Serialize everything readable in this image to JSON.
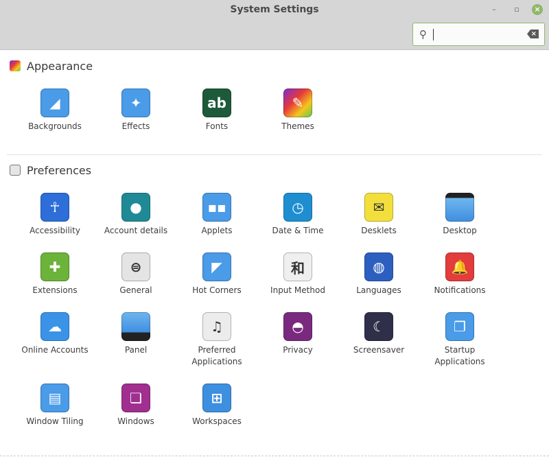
{
  "window": {
    "title": "System Settings",
    "minimize": "–",
    "restore": "▫",
    "close": "×"
  },
  "search": {
    "value": "",
    "icon": "search-icon",
    "clear_icon": "clear-icon"
  },
  "sections": [
    {
      "id": "appearance",
      "title": "Appearance",
      "icon": "appearance-icon",
      "items": [
        {
          "label": "Backgrounds",
          "icon": "backgrounds-icon",
          "bg": "#4a9be8"
        },
        {
          "label": "Effects",
          "icon": "effects-icon",
          "bg": "#4a9be8"
        },
        {
          "label": "Fonts",
          "icon": "fonts-icon",
          "bg": "#1d5a3a"
        },
        {
          "label": "Themes",
          "icon": "themes-icon",
          "bg": "#c23fb0"
        }
      ]
    },
    {
      "id": "preferences",
      "title": "Preferences",
      "icon": "preferences-icon",
      "items": [
        {
          "label": "Accessibility",
          "icon": "accessibility-icon",
          "bg": "#2d6ed8"
        },
        {
          "label": "Account details",
          "icon": "account-icon",
          "bg": "#1f8a96"
        },
        {
          "label": "Applets",
          "icon": "applets-icon",
          "bg": "#4a9be8"
        },
        {
          "label": "Date & Time",
          "icon": "clock-icon",
          "bg": "#1e8ed0"
        },
        {
          "label": "Desklets",
          "icon": "desklets-icon",
          "bg": "#f3df3c"
        },
        {
          "label": "Desktop",
          "icon": "desktop-icon",
          "bg": "#4a9be8"
        },
        {
          "label": "Extensions",
          "icon": "puzzle-icon",
          "bg": "#6cb33a"
        },
        {
          "label": "General",
          "icon": "toggles-icon",
          "bg": "#e4e4e4"
        },
        {
          "label": "Hot Corners",
          "icon": "hot-corners-icon",
          "bg": "#4a9be8"
        },
        {
          "label": "Input Method",
          "icon": "input-method-icon",
          "bg": "#efefef"
        },
        {
          "label": "Languages",
          "icon": "globe-icon",
          "bg": "#2d5fc0"
        },
        {
          "label": "Notifications",
          "icon": "bell-icon",
          "bg": "#e23c3c"
        },
        {
          "label": "Online Accounts",
          "icon": "cloud-icon",
          "bg": "#3b93e8"
        },
        {
          "label": "Panel",
          "icon": "panel-icon",
          "bg": "#4a9be8"
        },
        {
          "label": "Preferred Applications",
          "icon": "preferred-apps-icon",
          "bg": "#ececec"
        },
        {
          "label": "Privacy",
          "icon": "mask-icon",
          "bg": "#7a2a7e"
        },
        {
          "label": "Screensaver",
          "icon": "moon-icon",
          "bg": "#2f2f4a"
        },
        {
          "label": "Startup Applications",
          "icon": "startup-icon",
          "bg": "#4a9be8"
        },
        {
          "label": "Window Tiling",
          "icon": "window-tiling-icon",
          "bg": "#4a9be8"
        },
        {
          "label": "Windows",
          "icon": "windows-icon",
          "bg": "#a02f8f"
        },
        {
          "label": "Workspaces",
          "icon": "workspaces-icon",
          "bg": "#3d8fe0"
        }
      ]
    }
  ]
}
